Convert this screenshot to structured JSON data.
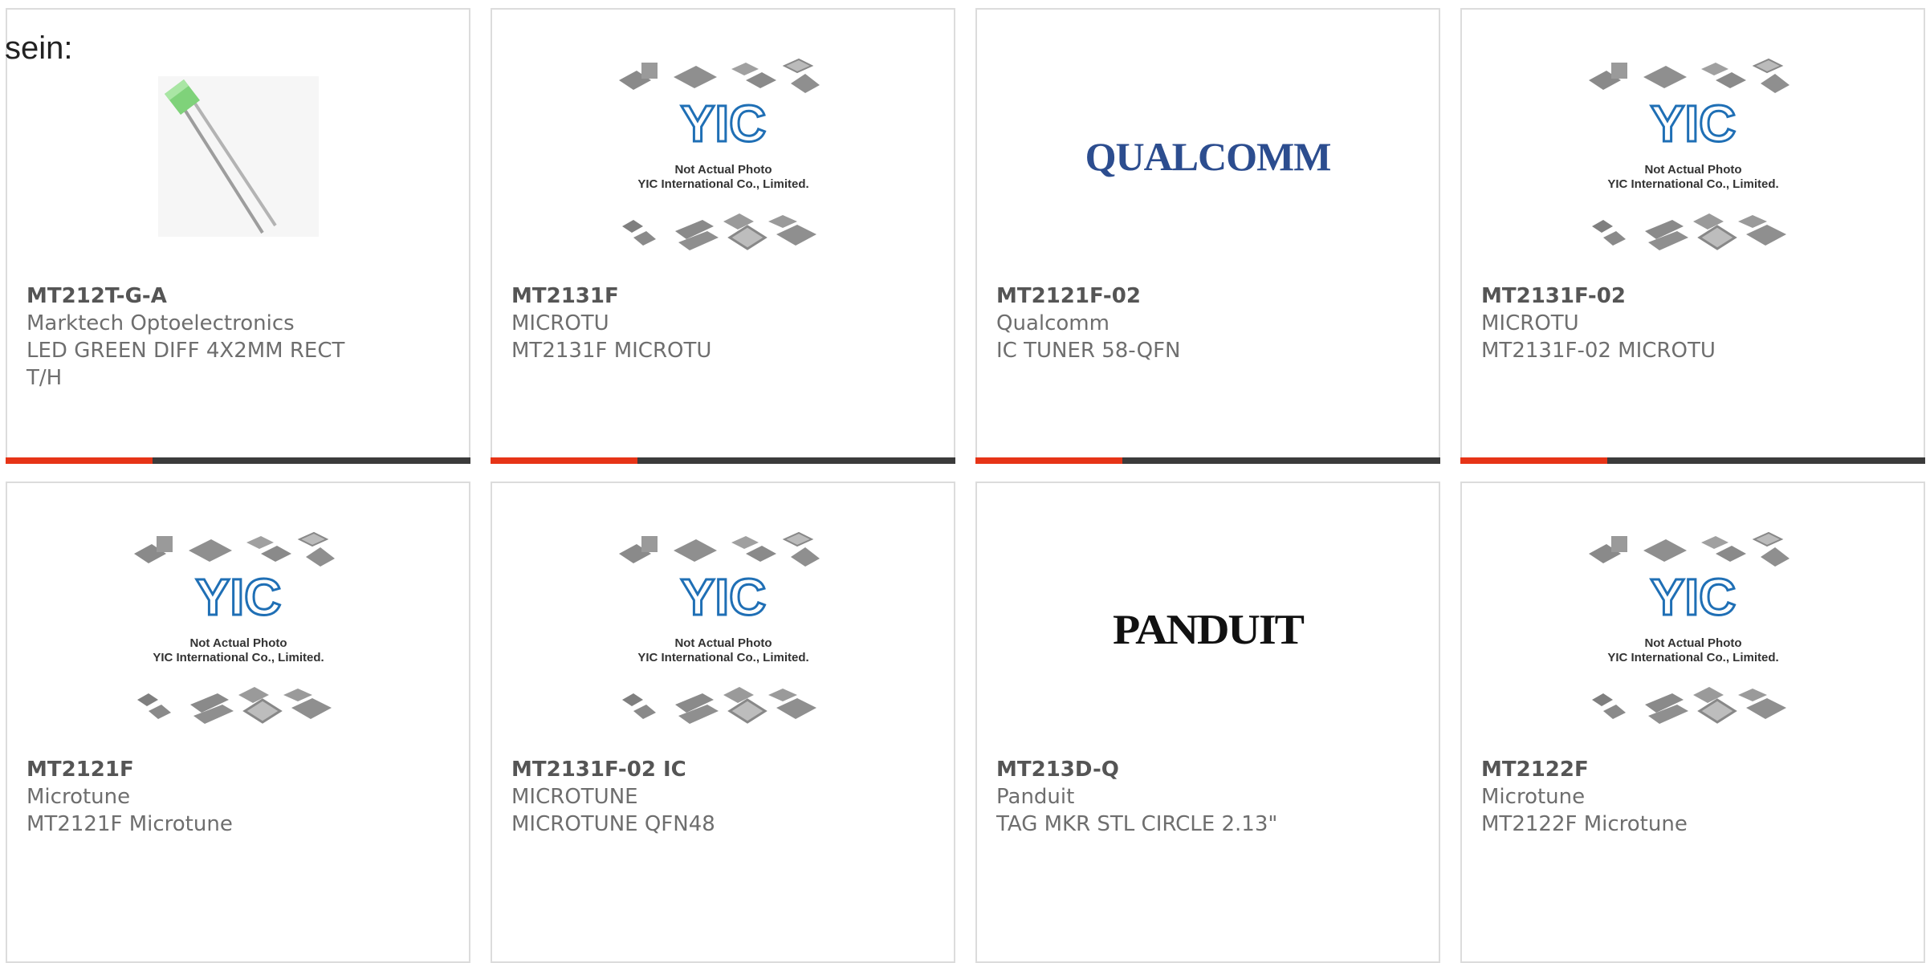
{
  "intro_text": "sein:",
  "placeholder": {
    "line1": "Not Actual Photo",
    "line2": "YIC International Co., Limited.",
    "logo": "YIC"
  },
  "products": [
    {
      "part_number": "MT212T-G-A",
      "manufacturer": "Marktech Optoelectronics",
      "description": "LED GREEN DIFF 4X2MM RECT T/H",
      "image": "green-led-photo"
    },
    {
      "part_number": "MT2131F",
      "manufacturer": "MICROTU",
      "description": "MT2131F MICROTU",
      "image": "yic-placeholder"
    },
    {
      "part_number": "MT2121F-02",
      "manufacturer": "Qualcomm",
      "description": "IC TUNER 58-QFN",
      "image": "qualcomm-logo",
      "brand_text": "QUALCOMM"
    },
    {
      "part_number": "MT2131F-02",
      "manufacturer": "MICROTU",
      "description": "MT2131F-02 MICROTU",
      "image": "yic-placeholder"
    },
    {
      "part_number": "MT2121F",
      "manufacturer": "Microtune",
      "description": "MT2121F Microtune",
      "image": "yic-placeholder"
    },
    {
      "part_number": "MT2131F-02 IC",
      "manufacturer": "MICROTUNE",
      "description": "MICROTUNE QFN48",
      "image": "yic-placeholder"
    },
    {
      "part_number": "MT213D-Q",
      "manufacturer": "Panduit",
      "description": "TAG MKR STL CIRCLE 2.13\"",
      "image": "panduit-logo",
      "brand_text": "PANDUIT"
    },
    {
      "part_number": "MT2122F",
      "manufacturer": "Microtune",
      "description": "MT2122F Microtune",
      "image": "yic-placeholder"
    }
  ],
  "colors": {
    "accent": "#e63417",
    "bar": "#3b3b3b",
    "qualcomm": "#2c4d8f",
    "yic": "#1f6fb5"
  }
}
